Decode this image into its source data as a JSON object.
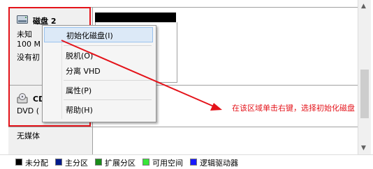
{
  "disk2": {
    "title": "磁盘 2",
    "type": "未知",
    "size": "100 M",
    "status": "没有初"
  },
  "cdrom": {
    "title": "CD",
    "type": "DVD (",
    "media": "无媒体"
  },
  "context_menu": {
    "items": [
      {
        "label": "初始化磁盘(I)"
      },
      {
        "label": "脱机(O)"
      },
      {
        "label": "分离 VHD"
      },
      {
        "label": "属性(P)"
      },
      {
        "label": "帮助(H)"
      }
    ]
  },
  "annotation": {
    "text": "在该区域单击右键，选择初始化磁盘",
    "color": "#e4131a"
  },
  "legend": [
    {
      "label": "未分配",
      "color": "#000000"
    },
    {
      "label": "主分区",
      "color": "#001a8c"
    },
    {
      "label": "扩展分区",
      "color": "#1a8c1a"
    },
    {
      "label": "可用空间",
      "color": "#39e639"
    },
    {
      "label": "逻辑驱动器",
      "color": "#1a1aff"
    }
  ],
  "icons": [
    "disk-icon",
    "cdrom-icon",
    "scroll-up-icon",
    "scroll-down-icon"
  ]
}
